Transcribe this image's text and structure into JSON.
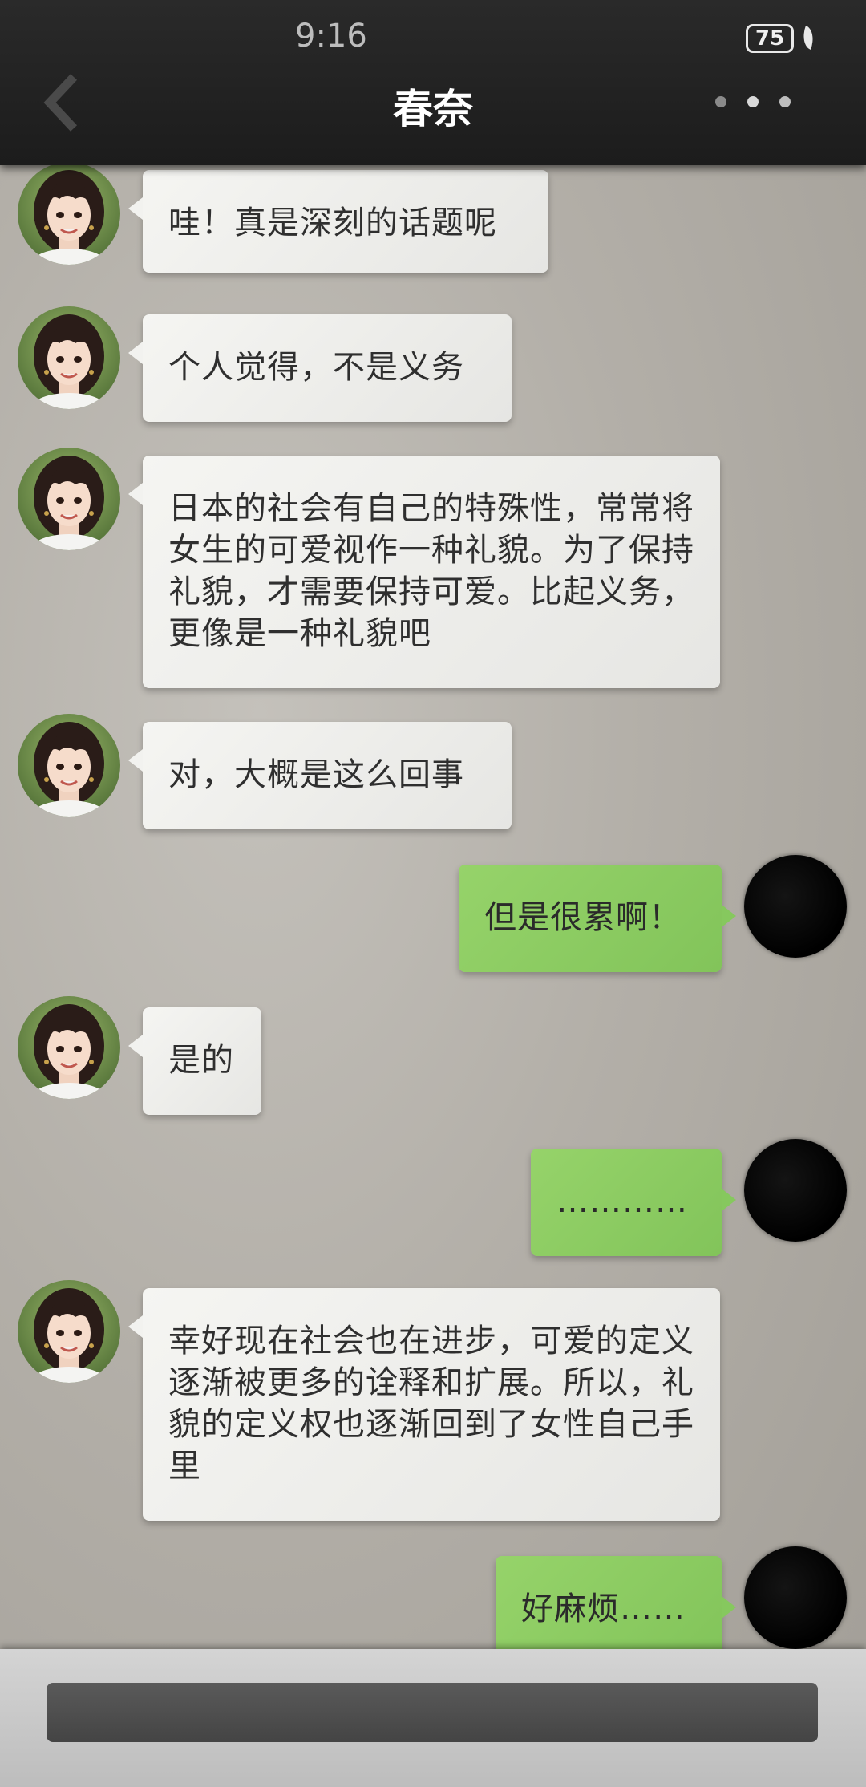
{
  "status_bar": {
    "time": "9:16",
    "battery": "75"
  },
  "header": {
    "title": "春奈"
  },
  "messages": [
    {
      "sender": "contact",
      "text": "哇！真是深刻的话题呢"
    },
    {
      "sender": "contact",
      "text": "个人觉得，不是义务"
    },
    {
      "sender": "contact",
      "text": "日本的社会有自己的特殊性，常常将女生的可爱视作一种礼貌。为了保持礼貌，才需要保持可爱。比起义务，更像是一种礼貌吧"
    },
    {
      "sender": "contact",
      "text": "对，大概是这么回事"
    },
    {
      "sender": "self",
      "text": "但是很累啊！"
    },
    {
      "sender": "contact",
      "text": "是的"
    },
    {
      "sender": "self",
      "text": "…………"
    },
    {
      "sender": "contact",
      "text": "幸好现在社会也在进步，可爱的定义逐渐被更多的诠释和扩展。所以，礼貌的定义权也逐渐回到了女性自己手里"
    },
    {
      "sender": "self",
      "text": "好麻烦……"
    }
  ],
  "input": {
    "value": ""
  },
  "colors": {
    "header": "#1f1f1f",
    "bubble_in": "#efefec",
    "bubble_out": "#8bcb60",
    "input_bar": "#4e4e4e"
  },
  "icons": {
    "back": "chevron-left-icon",
    "more": "more-dots-icon"
  }
}
